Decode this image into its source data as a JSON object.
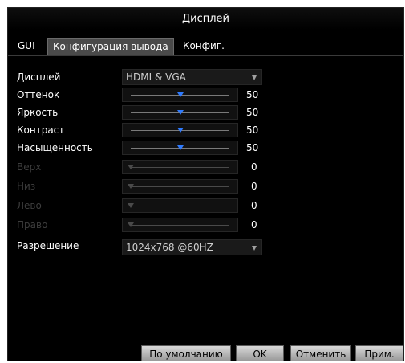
{
  "window": {
    "title": "Дисплей"
  },
  "tabs": [
    "GUI",
    "Конфигурация вывода",
    "Конфиг."
  ],
  "rows": {
    "display": {
      "label": "Дисплей",
      "value": "HDMI & VGA"
    },
    "hue": {
      "label": "Оттенок",
      "value": "50",
      "level": 0.5
    },
    "brightness": {
      "label": "Яркость",
      "value": "50",
      "level": 0.5
    },
    "contrast": {
      "label": "Контраст",
      "value": "50",
      "level": 0.5
    },
    "saturation": {
      "label": "Насыщенность",
      "value": "50",
      "level": 0.5
    },
    "top": {
      "label": "Верх",
      "value": "0",
      "level": 0
    },
    "bottom": {
      "label": "Низ",
      "value": "0",
      "level": 0
    },
    "left": {
      "label": "Лево",
      "value": "0",
      "level": 0
    },
    "right": {
      "label": "Право",
      "value": "0",
      "level": 0
    },
    "resolution": {
      "label": "Разрешение",
      "value": "1024x768 @60HZ"
    }
  },
  "buttons": {
    "default": "По умолчанию",
    "ok": "OK",
    "cancel": "Отменить",
    "apply": "Прим."
  },
  "colors": {
    "thumb": "#2f7bff",
    "active_tab": "#4a4a4a",
    "disabled_label": "#3d3d3d"
  }
}
